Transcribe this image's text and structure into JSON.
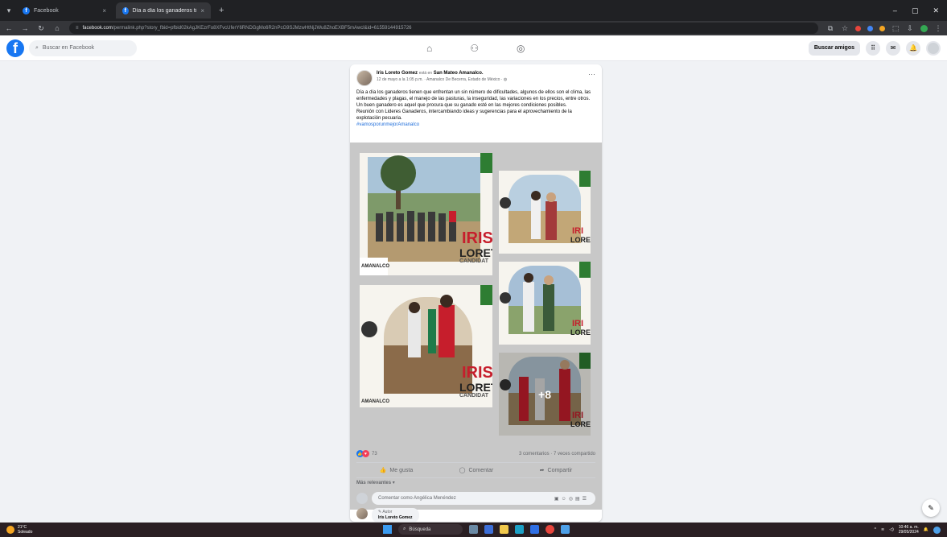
{
  "browser": {
    "tabs": [
      {
        "title": "Facebook",
        "active": false
      },
      {
        "title": "Día a día los ganaderos tienen",
        "active": true
      }
    ],
    "url_domain": "facebook.com",
    "url_path": "/permalink.php?story_fbid=pfbid02kAgJKEzrFo8XFvcUferY6RNDGgMo6R2nPcG9SJMzwHtNjJWu8ZhoEXBF5mAwcl&id=61559144915726"
  },
  "fb": {
    "search_placeholder": "Buscar en Facebook",
    "find_friends": "Buscar amigos"
  },
  "post": {
    "author": "Iris Loreto Gomez",
    "is_at": "está en",
    "place": "San Mateo Amanalco.",
    "meta": "12 de mayo a la 1:05 p.m. · Amanalco De Becerra, Estado de México ·",
    "paragraph1": "Día a día los ganaderos tienen que enfrentan un sin número de dificultades, algunos de ellos son el clima, las enfermedades y plagas, el manejo de las pasturas, la inseguridad, las variaciones en los precios, entre otros.",
    "paragraph2": "Un buen ganadero es aquel que procura que su ganado esté en las mejores condiciones posibles.",
    "paragraph3": "Reunión con Lideres Ganaderos, intercambiando ideas y sugerencias para el aprovechamiento de la explotación pecuaria.",
    "hashtag": "#vamosporunmejorAmanalco",
    "photos": {
      "big_word1": "IRIS",
      "big_word2": "LORET",
      "candidate": "CANDIDAT",
      "small_word1": "IRI",
      "small_word2": "LORE",
      "more_count": "+8",
      "caption": "PRESIDENTA MUNICIPAL AMANALCO",
      "left_badge": "AMANALCO"
    },
    "reaction_count": "73",
    "comments_shares": "3 comentarios · 7 veces compartido",
    "like_label": "Me gusta",
    "comment_label": "Comentar",
    "share_label": "Compartir",
    "relevance": "Más relevantes",
    "comment_placeholder": "Comentar como Angélica Menéndez",
    "first_comment_role": "Autor",
    "first_comment_name": "Iris Loreto Gomez"
  },
  "taskbar": {
    "weather_temp": "21°C",
    "weather_desc": "Soleado",
    "search_label": "Búsqueda",
    "time": "10:46 a. m.",
    "date": "29/05/2024"
  },
  "colors": {
    "fb_blue": "#1877f2",
    "accent_red": "#c61e2c"
  }
}
